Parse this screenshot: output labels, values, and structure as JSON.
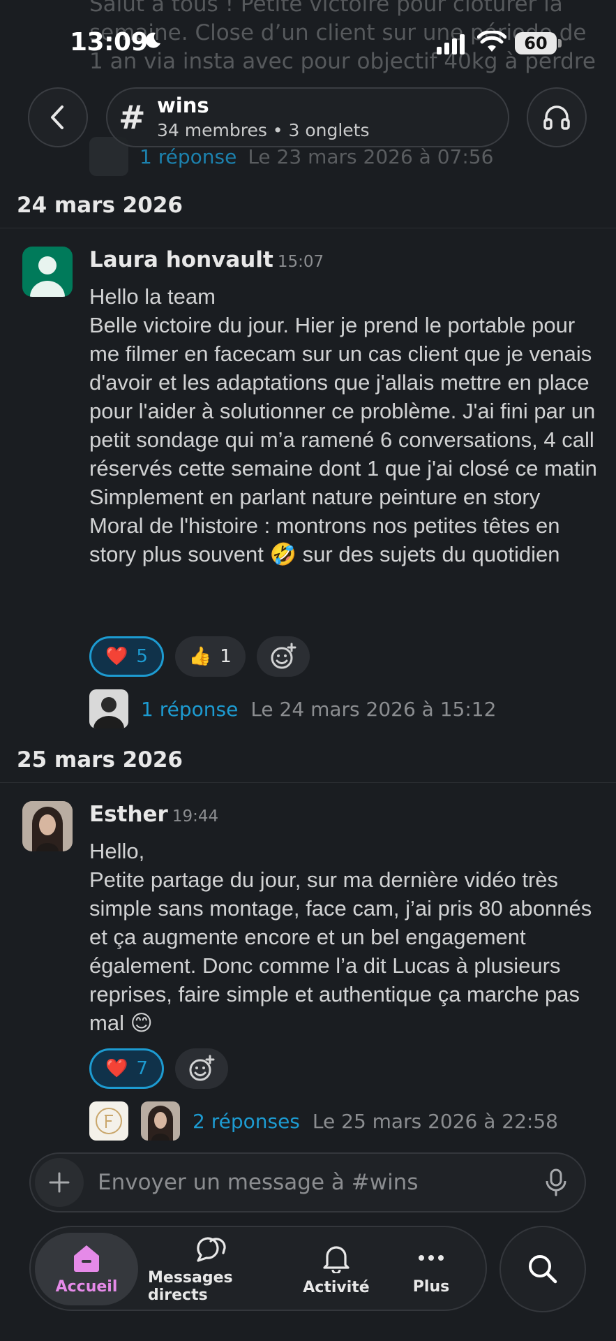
{
  "status_bar": {
    "time": "13:09",
    "battery": "60"
  },
  "ghost": {
    "text": "Salut à tous ! Petite victoire pour clôturer la semaine. Close d’un client sur une période de 1 an via insta avec pour objectif 40kg à perdre",
    "reply_count": "1 réponse",
    "reply_time": "Le 23 mars 2026 à 07:56"
  },
  "channel": {
    "name": "wins",
    "meta": "34 membres • 3 onglets"
  },
  "days": [
    "24 mars 2026",
    "25 mars 2026"
  ],
  "messages": [
    {
      "sender": "Laura honvault",
      "time": "15:07",
      "text": "Hello la team\nBelle victoire du jour. Hier je prend le portable pour me filmer en facecam sur un cas client que je venais d'avoir et les adaptations que j'allais mettre en place pour l'aider à solutionner ce problème. J'ai fini par un petit sondage qui m’a ramené 6 conversations, 4 call réservés cette semaine dont 1 que j'ai closé ce matin\nSimplement en parlant nature peinture en story\nMoral de l'histoire : montrons nos petites têtes en story plus souvent 🤣 sur des sujets du quotidien",
      "reactions": [
        {
          "emoji": "❤️",
          "count": "5",
          "active": true
        },
        {
          "emoji": "👍",
          "count": "1",
          "active": false
        }
      ],
      "thread": {
        "replies": "1 réponse",
        "last": "Le 24 mars 2026 à 15:12"
      }
    },
    {
      "sender": "Esther",
      "time": "19:44",
      "text": "Hello,\nPetite partage du jour, sur ma dernière vidéo très simple sans montage, face cam, j’ai pris 80 abonnés et ça augmente encore et un bel engagement également. Donc comme l’a dit Lucas à plusieurs reprises, faire simple et authentique ça marche pas mal 😊",
      "reactions": [
        {
          "emoji": "❤️",
          "count": "7",
          "active": true
        }
      ],
      "thread": {
        "replies": "2 réponses",
        "last": "Le 25 mars 2026 à 22:58"
      }
    }
  ],
  "composer": {
    "placeholder": "Envoyer un message à #wins"
  },
  "tabs": [
    {
      "label": "Accueil",
      "icon": "home-icon"
    },
    {
      "label": "Messages directs",
      "icon": "chat-bubbles-icon"
    },
    {
      "label": "Activité",
      "icon": "bell-icon"
    },
    {
      "label": "Plus",
      "icon": "ellipsis-icon"
    }
  ],
  "colors": {
    "background": "#1a1d21",
    "link": "#1d9bd1",
    "active_tab": "#e58ae8",
    "avatar_green": "#007a5a"
  }
}
